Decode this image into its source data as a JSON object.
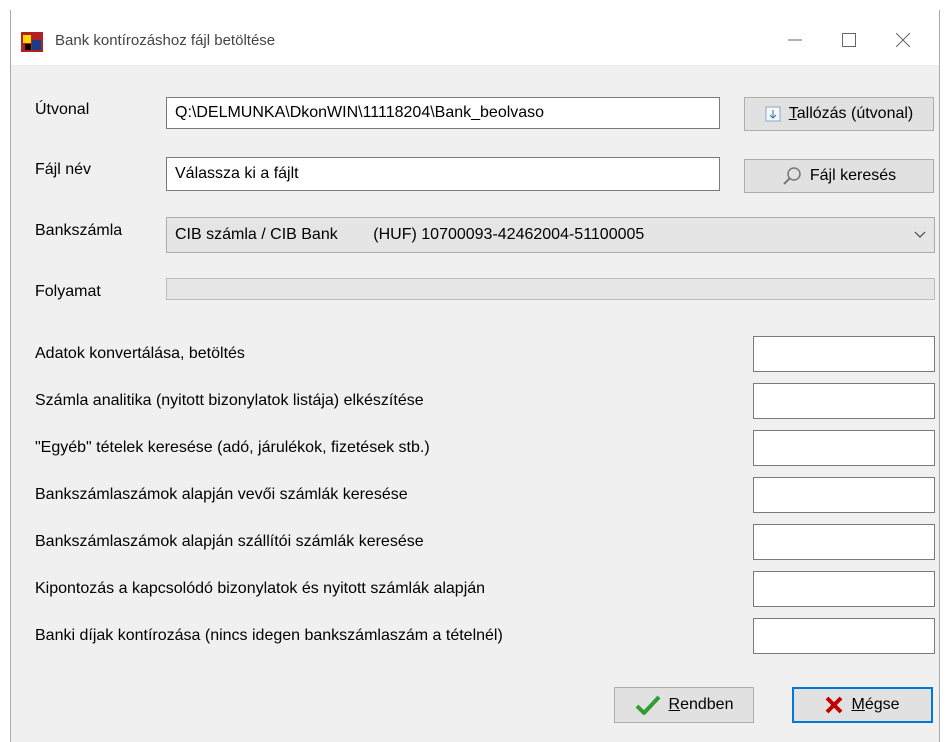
{
  "window": {
    "title": "Bank kontírozáshoz fájl betöltése"
  },
  "form": {
    "path_label": "Útvonal",
    "path_value": "Q:\\DELMUNKA\\DkonWIN\\11118204\\Bank_beolvaso",
    "browse_prefix": "T",
    "browse_rest": "allózás (útvonal)",
    "file_label": "Fájl név",
    "file_value": "Válassza ki a fájlt",
    "file_search_label": "Fájl keresés",
    "account_label": "Bankszámla",
    "account_value": "CIB számla / CIB Bank        (HUF) 10700093-42462004-51100005",
    "progress_label": "Folyamat",
    "progress_value": 0
  },
  "steps": [
    "Adatok konvertálása, betöltés",
    "Számla analitika (nyitott bizonylatok listája) elkészítése",
    "\"Egyéb\" tételek keresése (adó, járulékok, fizetések stb.)",
    "Bankszámlaszámok alapján vevői számlák keresése",
    "Bankszámlaszámok alapján szállítói számlák keresése",
    "Kipontozás a kapcsolódó bizonylatok és nyitott számlák alapján",
    "Banki díjak kontírozása (nincs idegen bankszámlaszám a tételnél)"
  ],
  "buttons": {
    "ok_prefix": "R",
    "ok_rest": "endben",
    "cancel_prefix": "M",
    "cancel_rest": "égse"
  },
  "icons": {
    "app": "bank-app-icon",
    "browse": "folder-browse-icon",
    "search": "magnifier-icon",
    "ok": "checkmark-icon",
    "cancel": "x-mark-icon"
  }
}
